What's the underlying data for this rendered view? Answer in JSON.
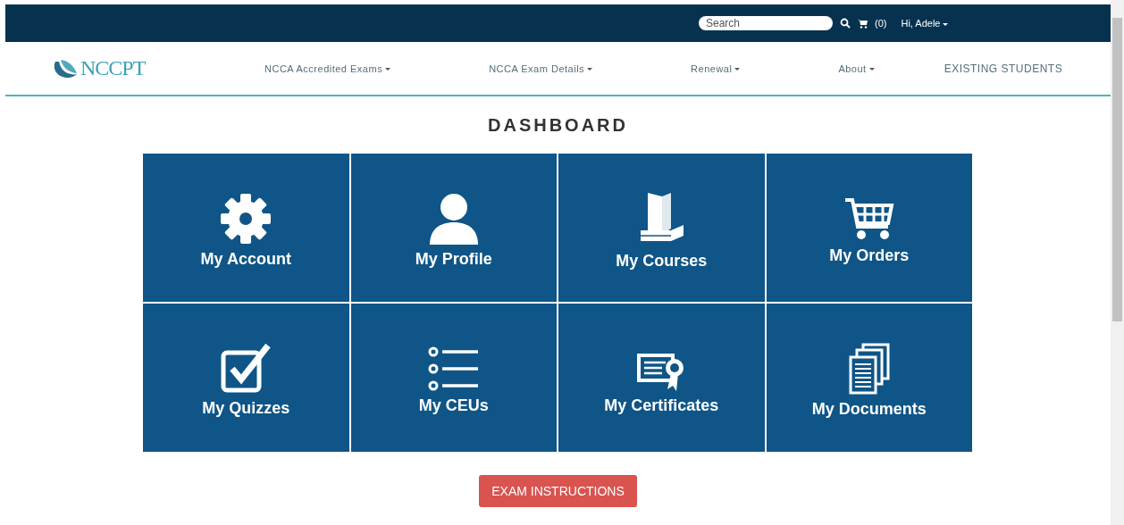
{
  "top_bar": {
    "search": {
      "placeholder": "Search"
    },
    "cart": "(0)",
    "user": "Hi, Adele"
  },
  "nav": {
    "logo": "NCCPT",
    "items": [
      {
        "label": "NCCA Accredited Exams",
        "has_menu": true
      },
      {
        "label": "NCCA Exam Details",
        "has_menu": true
      },
      {
        "label": "Renewal",
        "has_menu": true
      },
      {
        "label": "About",
        "has_menu": true
      },
      {
        "label": "EXISTING STUDENTS",
        "has_menu": false
      }
    ]
  },
  "title": "DASHBOARD",
  "tiles": [
    {
      "label": "My Account",
      "kind": "gear"
    },
    {
      "label": "My Profile",
      "kind": "person"
    },
    {
      "label": "My Courses",
      "kind": "book"
    },
    {
      "label": "My Orders",
      "kind": "cart"
    },
    {
      "label": "My Quizzes",
      "kind": "checkbox"
    },
    {
      "label": "My CEUs",
      "kind": "list"
    },
    {
      "label": "My Certificates",
      "kind": "certificate"
    },
    {
      "label": "My Documents",
      "kind": "documents"
    }
  ],
  "button": "EXAM INSTRUCTIONS"
}
